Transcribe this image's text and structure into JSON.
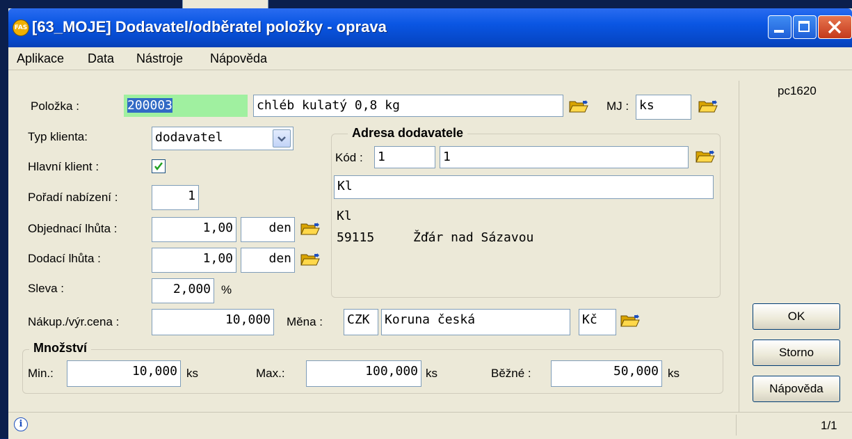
{
  "window": {
    "title": "[63_MOJE] Dodavatel/odběratel položky - oprava",
    "app_icon": "FAS"
  },
  "menu": [
    "Aplikace",
    "Data",
    "Nástroje",
    "Nápověda"
  ],
  "form": {
    "polozka_label": "Položka :",
    "polozka_code": "200003",
    "polozka_name": "chléb kulatý 0,8 kg",
    "mj_label": "MJ :",
    "mj_value": "ks",
    "typ_klienta_label": "Typ klienta:",
    "typ_klienta_value": "dodavatel",
    "hlavni_klient_label": "Hlavní klient :",
    "hlavni_klient_checked": true,
    "poradi_label": "Pořadí nabízení :",
    "poradi_value": "1",
    "objednaci_label": "Objednací lhůta :",
    "objednaci_value": "1,00",
    "objednaci_unit": "den",
    "dodaci_label": "Dodací lhůta :",
    "dodaci_value": "1,00",
    "dodaci_unit": "den",
    "sleva_label": "Sleva :",
    "sleva_value": "2,000",
    "sleva_unit": "%",
    "cena_label": "Nákup./výr.cena :",
    "cena_value": "10,000",
    "mena_label": "Měna :",
    "mena_code": "CZK",
    "mena_name": "Koruna česká",
    "mena_symbol": "Kč"
  },
  "adresa": {
    "title": "Adresa dodavatele",
    "kod_label": "Kód :",
    "kod_value": "1",
    "kod_name": "1",
    "name_field": "Kl",
    "addr_line1": "Kl",
    "addr_zip": "59115",
    "addr_city": "Žďár nad Sázavou"
  },
  "mnozstvi": {
    "title": "Množství",
    "min_label": "Min.:",
    "min_value": "10,000",
    "min_unit": "ks",
    "max_label": "Max.:",
    "max_value": "100,000",
    "max_unit": "ks",
    "bezne_label": "Běžné :",
    "bezne_value": "50,000",
    "bezne_unit": "ks"
  },
  "side": {
    "computer": "pc1620",
    "ok": "OK",
    "storno": "Storno",
    "napoveda": "Nápověda"
  },
  "status": {
    "page": "1/1"
  },
  "colors": {
    "highlight_field": "#a0f0a0",
    "selection": "#316ac5",
    "titlebar": "#0a56e3"
  }
}
